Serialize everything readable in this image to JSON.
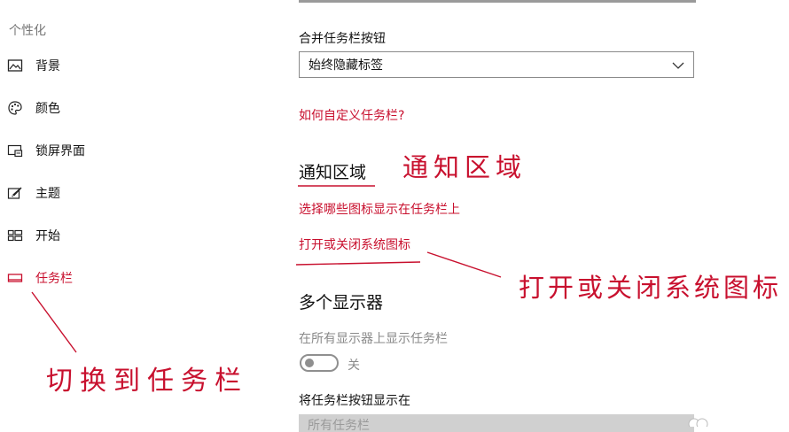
{
  "sidebar": {
    "header": "个性化",
    "items": [
      {
        "label": "背景",
        "icon": "picture-icon"
      },
      {
        "label": "颜色",
        "icon": "palette-icon"
      },
      {
        "label": "锁屏界面",
        "icon": "lock-screen-icon"
      },
      {
        "label": "主题",
        "icon": "theme-brush-icon"
      },
      {
        "label": "开始",
        "icon": "start-grid-icon"
      },
      {
        "label": "任务栏",
        "icon": "taskbar-icon",
        "active": true
      }
    ]
  },
  "content": {
    "combine_buttons_label": "合并任务栏按钮",
    "combine_buttons_value": "始终隐藏标签",
    "customize_link": "如何自定义任务栏?",
    "notification_area_title": "通知区域",
    "select_icons_link": "选择哪些图标显示在任务栏上",
    "system_icons_link": "打开或关闭系统图标",
    "multi_display_title": "多个显示器",
    "show_on_all_label": "在所有显示器上显示任务栏",
    "show_on_all_state": "关",
    "show_buttons_on_label": "将任务栏按钮显示在",
    "show_buttons_on_value": "所有任务栏"
  },
  "annotations": {
    "notification_area": "通知区域",
    "system_icons": "打开或关闭系统图标",
    "switch_to_taskbar": "切换到任务栏"
  },
  "colors": {
    "accent_red": "#c8102e",
    "muted_gray": "#8a8a8a"
  }
}
